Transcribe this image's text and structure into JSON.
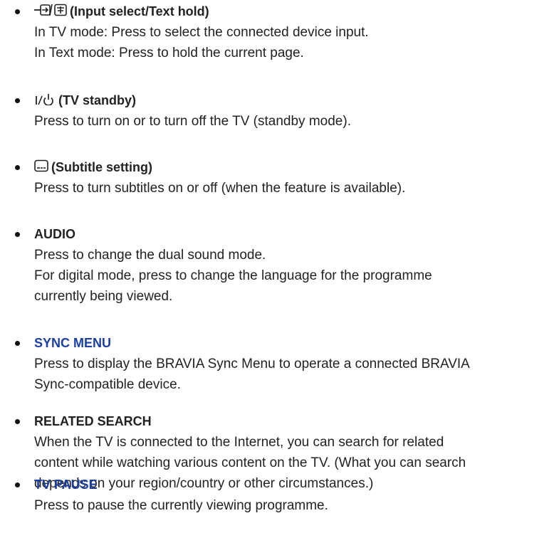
{
  "items": [
    {
      "title": "(Input select/Text hold)",
      "lines": [
        "In TV mode: Press to select the connected device input.",
        "In Text mode: Press to hold the current page."
      ]
    },
    {
      "title": "(TV standby)",
      "lines": [
        "Press to turn on or to turn off the TV (standby mode)."
      ]
    },
    {
      "title": "(Subtitle setting)",
      "lines": [
        "Press to turn subtitles on or off (when the feature is available)."
      ]
    },
    {
      "title": "AUDIO",
      "lines": [
        "Press to change the dual sound mode.",
        "For digital mode, press to change the language for the programme",
        "currently being viewed."
      ]
    },
    {
      "title": "SYNC MENU",
      "link": true,
      "lines": [
        "Press to display the BRAVIA Sync Menu to operate a connected BRAVIA",
        "Sync-compatible device."
      ]
    },
    {
      "title": "RELATED SEARCH",
      "lines": [
        "When the TV is connected to the Internet, you can search for related",
        "content while watching various content on the TV. (What you can search",
        "depends on your region/country or other circumstances.)"
      ]
    },
    {
      "title": "TV PAUSE",
      "link": true,
      "lines": [
        "Press to pause the currently viewing programme."
      ]
    }
  ],
  "colors": {
    "text": "#222222",
    "link": "#1a3fa0"
  },
  "icons": [
    "input-select-icon",
    "text-hold-icon",
    "power-standby-icon",
    "subtitle-icon"
  ]
}
